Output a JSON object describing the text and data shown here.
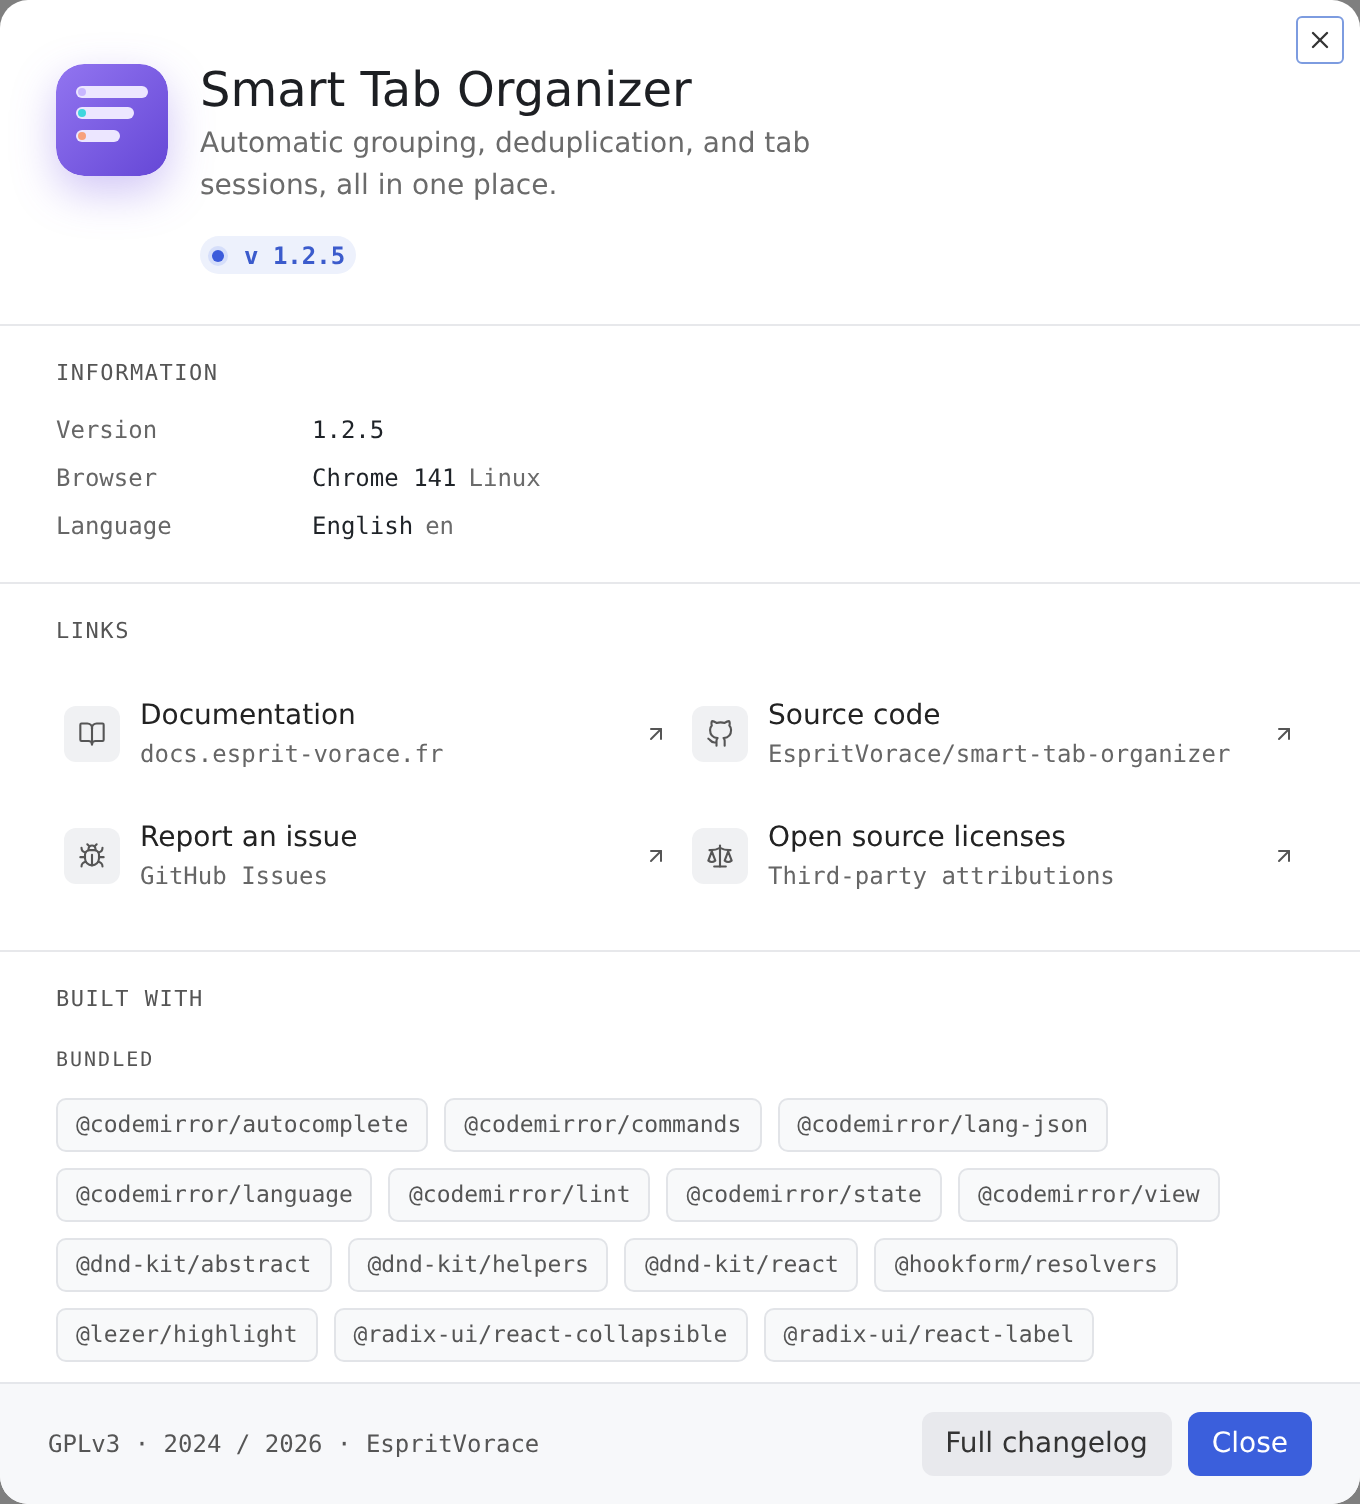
{
  "app": {
    "name": "Smart Tab Organizer",
    "description": "Automatic grouping, deduplication, and tab sessions, all in one place.",
    "version_badge": "v 1.2.5"
  },
  "information": {
    "heading": "INFORMATION",
    "rows": [
      {
        "label": "Version",
        "value": "1.2.5"
      },
      {
        "label": "Browser",
        "value": "Chrome 141",
        "detail": "Linux"
      },
      {
        "label": "Language",
        "value": "English",
        "detail": "en"
      }
    ]
  },
  "links": {
    "heading": "LINKS",
    "items": [
      {
        "title": "Documentation",
        "subtitle": "docs.esprit-vorace.fr"
      },
      {
        "title": "Source code",
        "subtitle": "EspritVorace/smart-tab-organizer"
      },
      {
        "title": "Report an issue",
        "subtitle": "GitHub Issues"
      },
      {
        "title": "Open source licenses",
        "subtitle": "Third-party attributions"
      }
    ]
  },
  "built_with": {
    "heading": "BUILT WITH",
    "groups": [
      {
        "heading": "BUNDLED",
        "packages": [
          "@codemirror/autocomplete",
          "@codemirror/commands",
          "@codemirror/lang-json",
          "@codemirror/language",
          "@codemirror/lint",
          "@codemirror/state",
          "@codemirror/view",
          "@dnd-kit/abstract",
          "@dnd-kit/helpers",
          "@dnd-kit/react",
          "@hookform/resolvers",
          "@lezer/highlight",
          "@radix-ui/react-collapsible",
          "@radix-ui/react-label"
        ]
      }
    ]
  },
  "footer": {
    "text": "GPLv3 · 2024 / 2026 · EspritVorace",
    "buttons": [
      {
        "label": "Full changelog",
        "kind": "secondary"
      },
      {
        "label": "Close",
        "kind": "primary"
      }
    ]
  }
}
